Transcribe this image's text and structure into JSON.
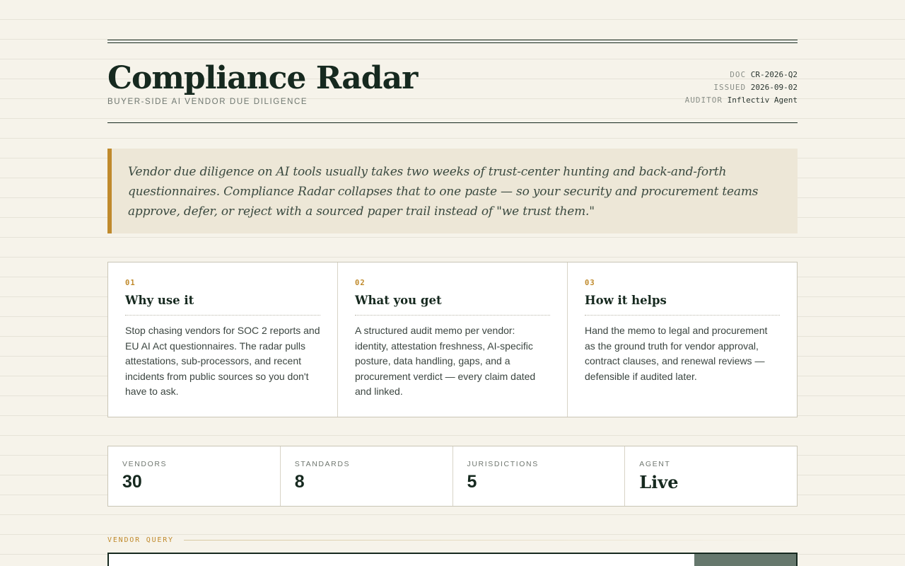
{
  "header": {
    "title": "Compliance Radar",
    "subtitle": "BUYER-SIDE AI VENDOR DUE DILIGENCE",
    "meta": [
      {
        "key": "DOC",
        "value": "CR-2026-Q2"
      },
      {
        "key": "ISSUED",
        "value": "2026-09-02"
      },
      {
        "key": "AUDITOR",
        "value": "Inflectiv Agent"
      }
    ]
  },
  "intro": {
    "quote": "Vendor due diligence on AI tools usually takes two weeks of trust-center hunting and back-and-forth questionnaires. Compliance Radar collapses that to one paste — so your security and procurement teams approve, defer, or reject with a sourced paper trail instead of \"we trust them.\""
  },
  "features": [
    {
      "number": "01",
      "title": "Why use it",
      "body": "Stop chasing vendors for SOC 2 reports and EU AI Act questionnaires. The radar pulls attestations, sub-processors, and recent incidents from public sources so you don't have to ask."
    },
    {
      "number": "02",
      "title": "What you get",
      "body": "A structured audit memo per vendor: identity, attestation freshness, AI-specific posture, data handling, gaps, and a procurement verdict — every claim dated and linked."
    },
    {
      "number": "03",
      "title": "How it helps",
      "body": "Hand the memo to legal and procurement as the ground truth for vendor approval, contract clauses, and renewal reviews — defensible if audited later."
    }
  ],
  "stats": [
    {
      "label": "VENDORS",
      "value": "30"
    },
    {
      "label": "STANDARDS",
      "value": "8"
    },
    {
      "label": "JURISDICTIONS",
      "value": "5"
    },
    {
      "label": "AGENT",
      "value": "Live"
    }
  ],
  "query": {
    "label": "VENDOR QUERY",
    "input_value": "",
    "button_label": ""
  },
  "colors": {
    "accent": "#c08a2c",
    "ink": "#16291f",
    "paper": "#f6f3ea",
    "button": "#66786d"
  }
}
